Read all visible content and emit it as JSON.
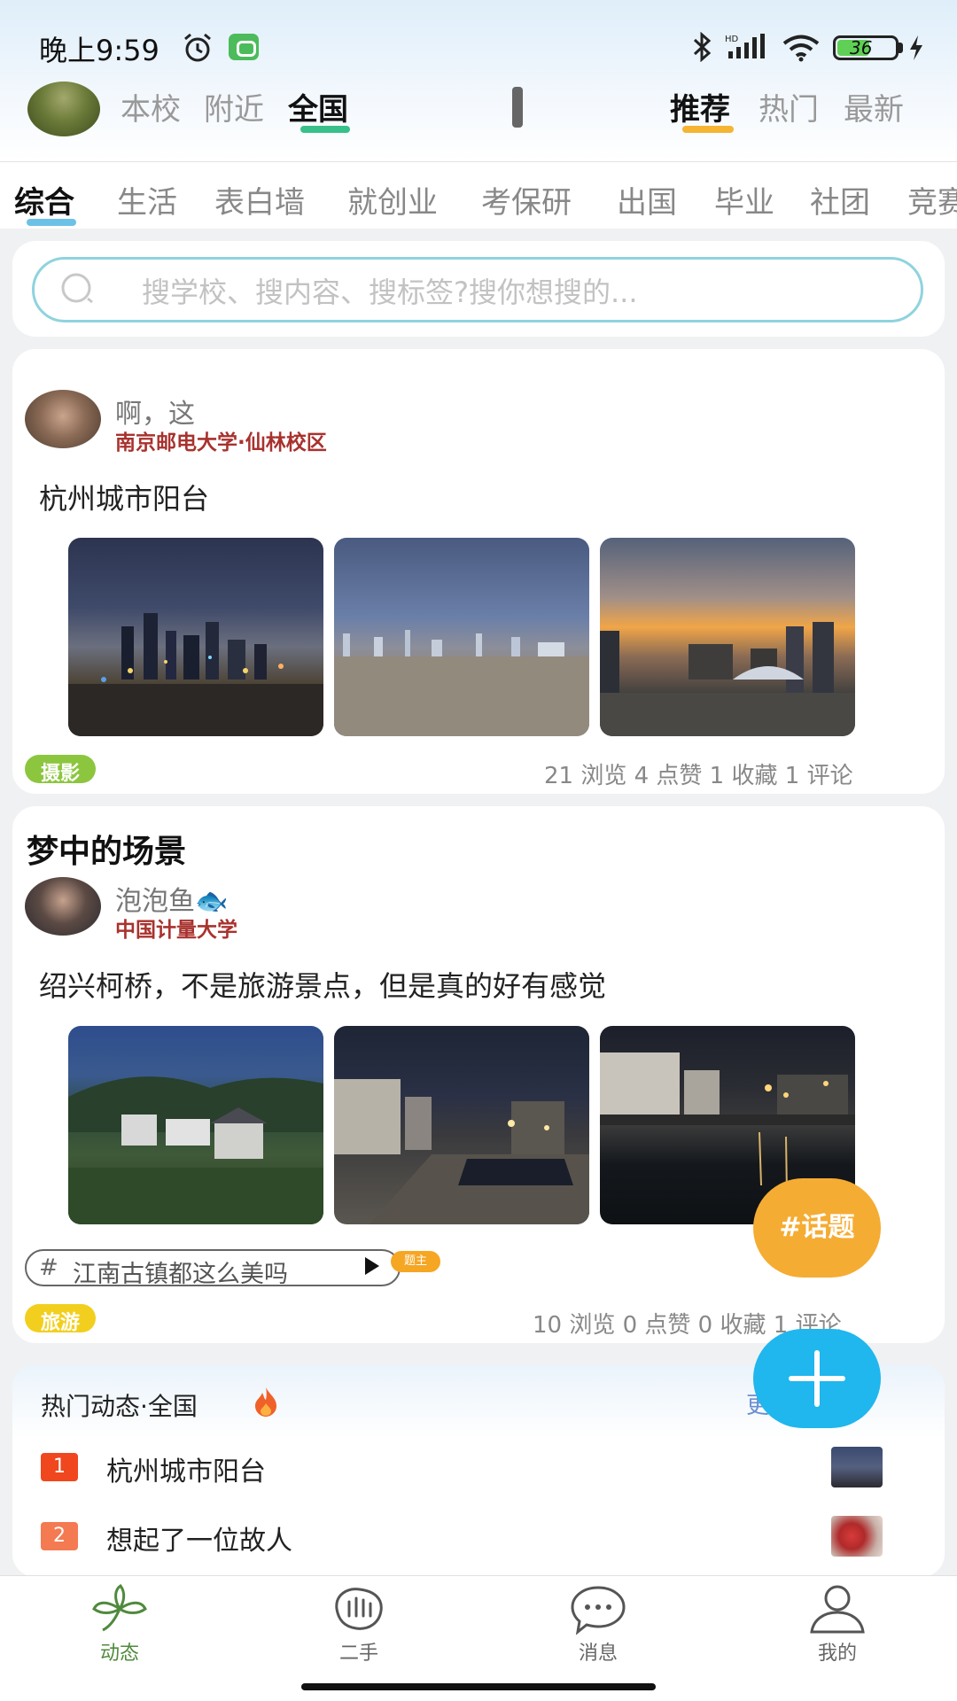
{
  "status_bar": {
    "time": "晚上9:59",
    "battery": "36"
  },
  "header": {
    "scope_tabs": [
      "本校",
      "附近",
      "全国"
    ],
    "active_scope": "全国",
    "sort_tabs": [
      "推荐",
      "热门",
      "最新"
    ],
    "active_sort": "推荐"
  },
  "categories": [
    "综合",
    "生活",
    "表白墙",
    "就创业",
    "考保研",
    "出国",
    "毕业",
    "社团",
    "竞赛"
  ],
  "search": {
    "placeholder": "搜学校、搜内容、搜标签?搜你想搜的..."
  },
  "posts": [
    {
      "author": "啊，这",
      "school": "南京邮电大学·仙林校区",
      "content": "杭州城市阳台",
      "tag": "摄影",
      "tag_color": "#8cc63f",
      "stats": "21 浏览   4 点赞   1 收藏   1 评论"
    },
    {
      "title": "梦中的场景",
      "author": "泡泡鱼🐟",
      "school": "中国计量大学",
      "content": "绍兴柯桥，不是旅游景点，但是真的好有感觉",
      "topic_hash": "#",
      "topic": "江南古镇都这么美吗",
      "owner_badge": "题主",
      "tag": "旅游",
      "tag_color": "#f2cf1e",
      "stats": "10 浏览   0 点赞   0 收藏   1 评论"
    }
  ],
  "fab": {
    "topic_label": "#话题"
  },
  "hot": {
    "title": "热门动态·全国",
    "more": "更多 >",
    "items": [
      {
        "rank": "1",
        "text": "杭州城市阳台",
        "rank_color": "#f0471f"
      },
      {
        "rank": "2",
        "text": "想起了一位故人",
        "rank_color": "#f47a52"
      }
    ]
  },
  "bottom_nav": [
    {
      "label": "动态",
      "icon": "leaf-icon",
      "active": true
    },
    {
      "label": "二手",
      "icon": "hand-icon"
    },
    {
      "label": "消息",
      "icon": "chat-icon"
    },
    {
      "label": "我的",
      "icon": "user-icon"
    }
  ]
}
